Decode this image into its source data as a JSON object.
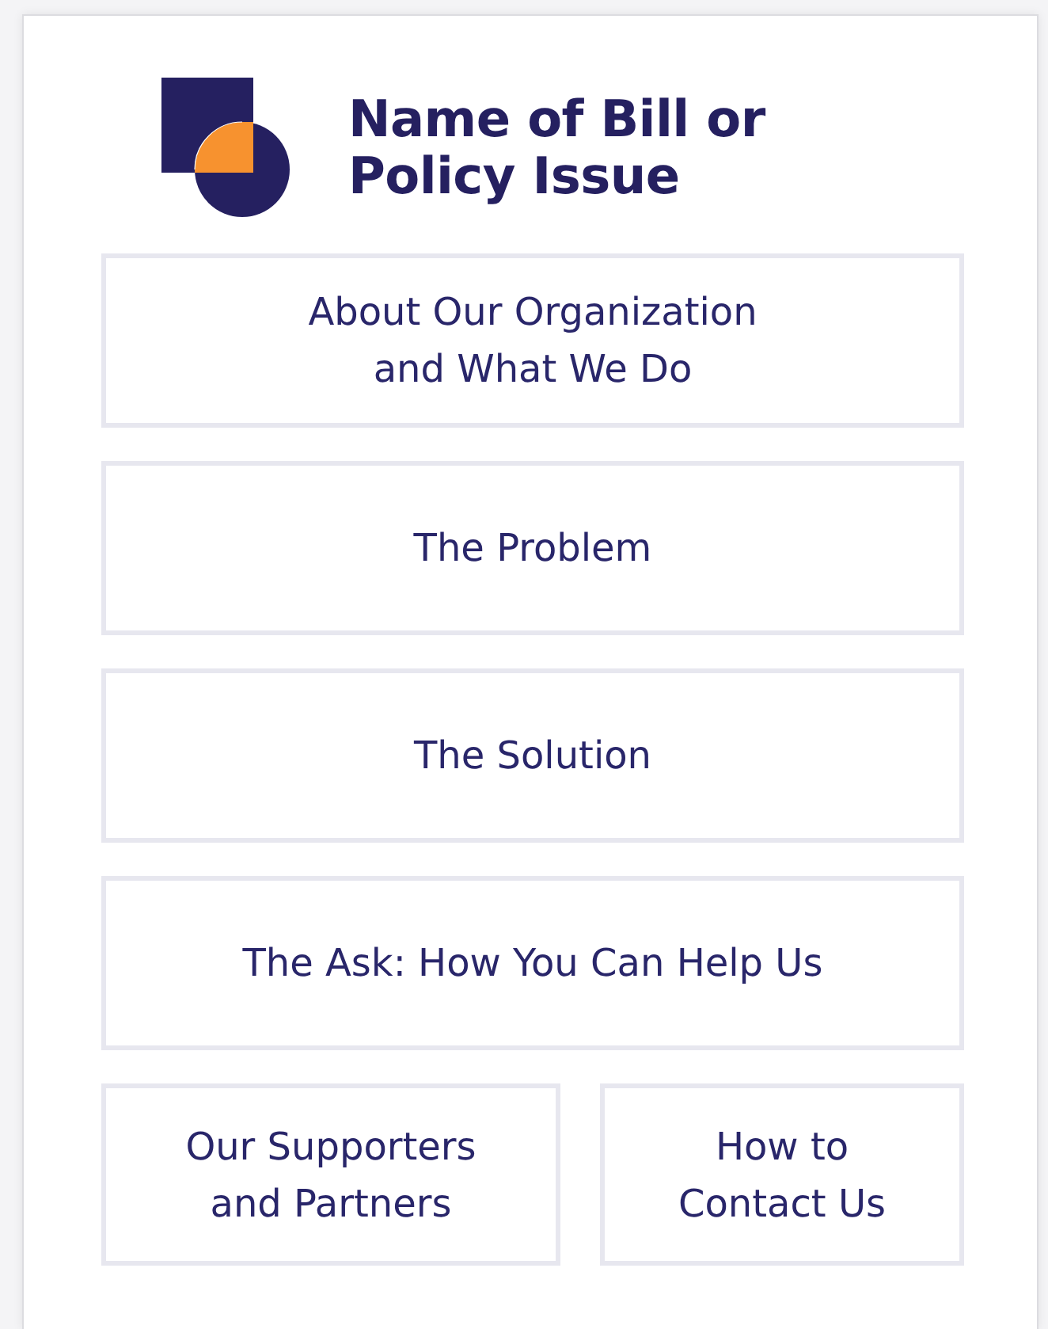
{
  "header": {
    "title": "Name of Bill or\nPolicy Issue"
  },
  "nav_rows": [
    [
      "About Our Organization\nand What We Do"
    ],
    [
      "The Problem"
    ],
    [
      "The Solution"
    ],
    [
      "The Ask: How You Can Help Us"
    ],
    [
      "Our Supporters\nand Partners",
      "How to\nContact Us"
    ]
  ]
}
